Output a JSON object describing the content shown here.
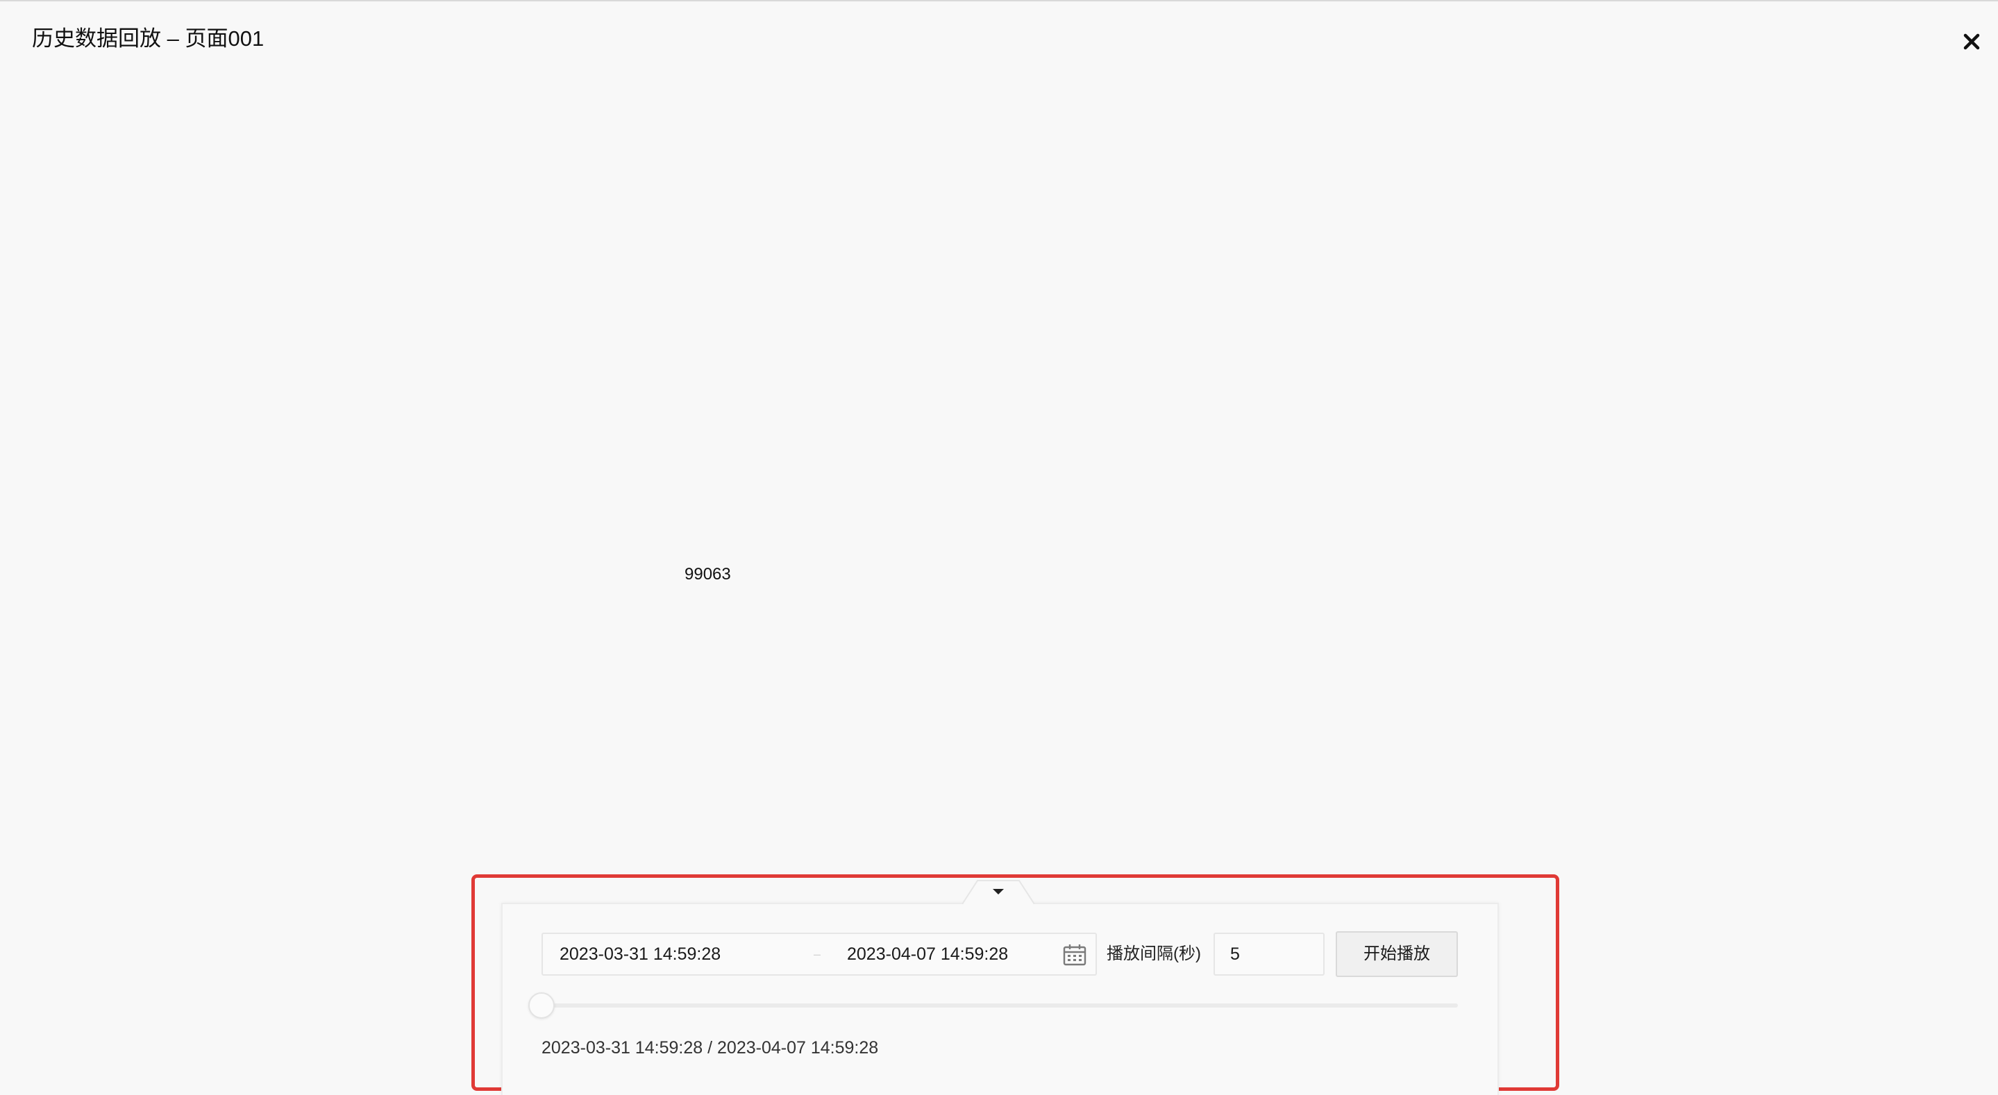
{
  "header": {
    "title": "历史数据回放 – 页面001",
    "close_icon": "close-icon"
  },
  "canvas": {
    "value_label": "99063"
  },
  "playback": {
    "toggle_icon": "caret-down-icon",
    "range": {
      "start": "2023-03-31 14:59:28",
      "separator": "–",
      "end": "2023-04-07 14:59:28",
      "calendar_icon": "calendar-icon"
    },
    "interval_label": "播放间隔(秒)",
    "interval_value": "5",
    "play_button_label": "开始播放",
    "progress": {
      "fraction": 0.0,
      "current": "2023-03-31 14:59:28",
      "separator": "/",
      "total": "2023-04-07 14:59:28"
    }
  },
  "colors": {
    "background": "#f8f8f8",
    "highlight_border": "#e03a36",
    "panel_background": "#f9f9f9"
  }
}
